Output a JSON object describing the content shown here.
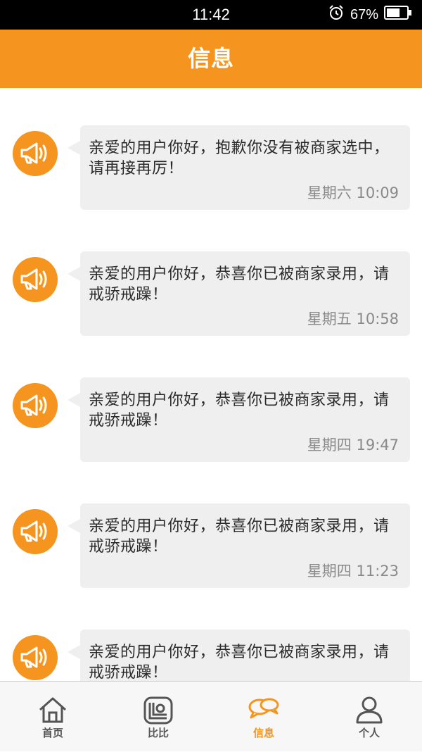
{
  "status_bar": {
    "time": "11:42",
    "battery_percent": "67%",
    "battery_level": 0.67,
    "icons": [
      "alarm-icon",
      "battery-icon"
    ]
  },
  "header": {
    "title": "信息"
  },
  "messages": [
    {
      "text": "亲爱的用户你好，抱歉你没有被商家选中，请再接再厉！",
      "time": "星期六 10:09"
    },
    {
      "text": "亲爱的用户你好，恭喜你已被商家录用，请戒骄戒躁！",
      "time": "星期五 10:58"
    },
    {
      "text": "亲爱的用户你好，恭喜你已被商家录用，请戒骄戒躁！",
      "time": "星期四 19:47"
    },
    {
      "text": "亲爱的用户你好，恭喜你已被商家录用，请戒骄戒躁！",
      "time": "星期四 11:23"
    },
    {
      "text": "亲爱的用户你好，恭喜你已被商家录用，请戒骄戒躁！",
      "time": ""
    }
  ],
  "tabs": [
    {
      "label": "首页",
      "icon": "home-icon"
    },
    {
      "label": "比比",
      "icon": "compare-icon"
    },
    {
      "label": "信息",
      "icon": "chat-icon",
      "active": true
    },
    {
      "label": "个人",
      "icon": "person-icon"
    }
  ],
  "colors": {
    "accent": "#f59520",
    "bubble": "#efefef",
    "status_bar": "#000000"
  }
}
